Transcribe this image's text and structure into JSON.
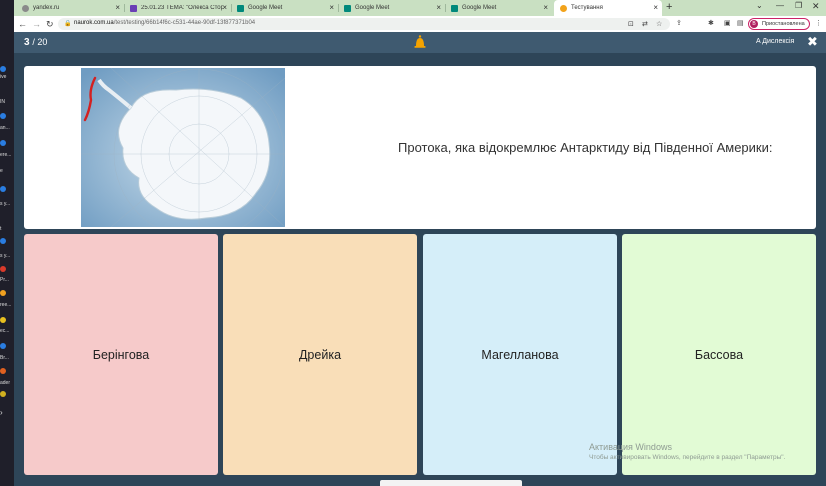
{
  "desktop": {
    "labels": [
      "ive",
      "IN",
      "an...",
      "ere...",
      "e",
      "s y...",
      "t",
      "s y...",
      "Pr...",
      "ree...",
      "ec...",
      "Br...",
      "ader"
    ]
  },
  "tabs": [
    {
      "title": "yandex.ru",
      "favicon_color": "#8a8a8a"
    },
    {
      "title": "25.01.23 ТЕМА: \"Олекса Сторо...",
      "favicon_color": "#6a3fb5"
    },
    {
      "title": "Google Meet",
      "favicon_color": "#00897b"
    },
    {
      "title": "Google Meet",
      "favicon_color": "#00897b"
    },
    {
      "title": "Google Meet",
      "favicon_color": "#00897b"
    },
    {
      "title": "Тестування",
      "favicon_color": "#f2a31b"
    }
  ],
  "address": {
    "host": "naurok.com.ua",
    "path": "/test/testing/66b14f6c-c531-44ae-90df-13f877371b04"
  },
  "profile": {
    "initial": "В",
    "label": "Приостановлена"
  },
  "quiz": {
    "current": "3",
    "total": "/ 20",
    "dyslexia_label": "Дислексія",
    "question": "Протока, яка відокремлює Антарктиду від Південної Америки:",
    "answers": [
      "Берінгова",
      "Дрейка",
      "Магелланова",
      "Бассова"
    ]
  },
  "watermark": {
    "title": "Активация Windows",
    "subtitle": "Чтобы активировать Windows, перейдите в раздел \"Параметры\"."
  },
  "colors": {
    "header": "#3f5a70",
    "stage": "#2e4558",
    "answer_1": "#f6caca",
    "answer_2": "#f9deb8",
    "answer_3": "#d5eef9",
    "answer_4": "#e2fbd5"
  }
}
